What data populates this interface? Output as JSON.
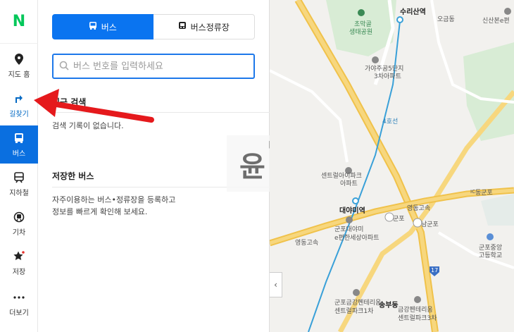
{
  "rail": {
    "logo": "N",
    "items": [
      {
        "label": "지도 홈",
        "icon": "map-pin-icon"
      },
      {
        "label": "길찾기",
        "icon": "route-arrow-icon"
      },
      {
        "label": "버스",
        "icon": "bus-icon"
      },
      {
        "label": "지하철",
        "icon": "subway-icon"
      },
      {
        "label": "기차",
        "icon": "train-icon"
      },
      {
        "label": "저장",
        "icon": "star-icon"
      },
      {
        "label": "더보기",
        "icon": "more-icon"
      }
    ]
  },
  "panel": {
    "tabs": [
      {
        "label": "버스",
        "icon": "bus-icon"
      },
      {
        "label": "버스정류장",
        "icon": "bus-stop-icon"
      }
    ],
    "search_placeholder": "버스 번호를 입력하세요",
    "recent_title": "최근 검색",
    "recent_empty": "검색 기록이 없습니다.",
    "saved_title": "저장한 버스",
    "saved_desc_1": "자주이용하는 버스•정류장을 등록하고",
    "saved_desc_2": "정보를 빠르게 확인해 보세요.",
    "watermark": "윤"
  },
  "map": {
    "labels": {
      "surisan_station": "수리산역",
      "ogeum_dong": "오금동",
      "chomak_park_1": "초막골",
      "chomak_park_2": "생태공원",
      "gaya_1": "가야주공5단지",
      "gaya_2": "3차아파트",
      "centrel_1": "센트럴아이파크",
      "centrel_2": "아파트",
      "daeyami": "대야미역",
      "gunpo_ic": "군포",
      "namgunpo": "남군포",
      "donggunpo": "동군포",
      "highway_1": "영동고속",
      "highway_2": "영동고속",
      "gunpo_daeyami_1": "군포대야미",
      "gunpo_daeyami_2": "e편한세상아파트",
      "gunpo_middle_1": "군포중앙",
      "gunpo_middle_2": "고등학교",
      "geumgang_1": "군포금강펜테리움",
      "geumgang_2": "센트럴파크1차",
      "songbu": "송부동",
      "geumgang3_1": "금강펜테리움",
      "geumgang3_2": "센트럴파크3차",
      "sinsan": "신산본e편",
      "route_17": "17",
      "line4": "4호선",
      "ic": "IC"
    },
    "collapse_glyph": "‹"
  }
}
